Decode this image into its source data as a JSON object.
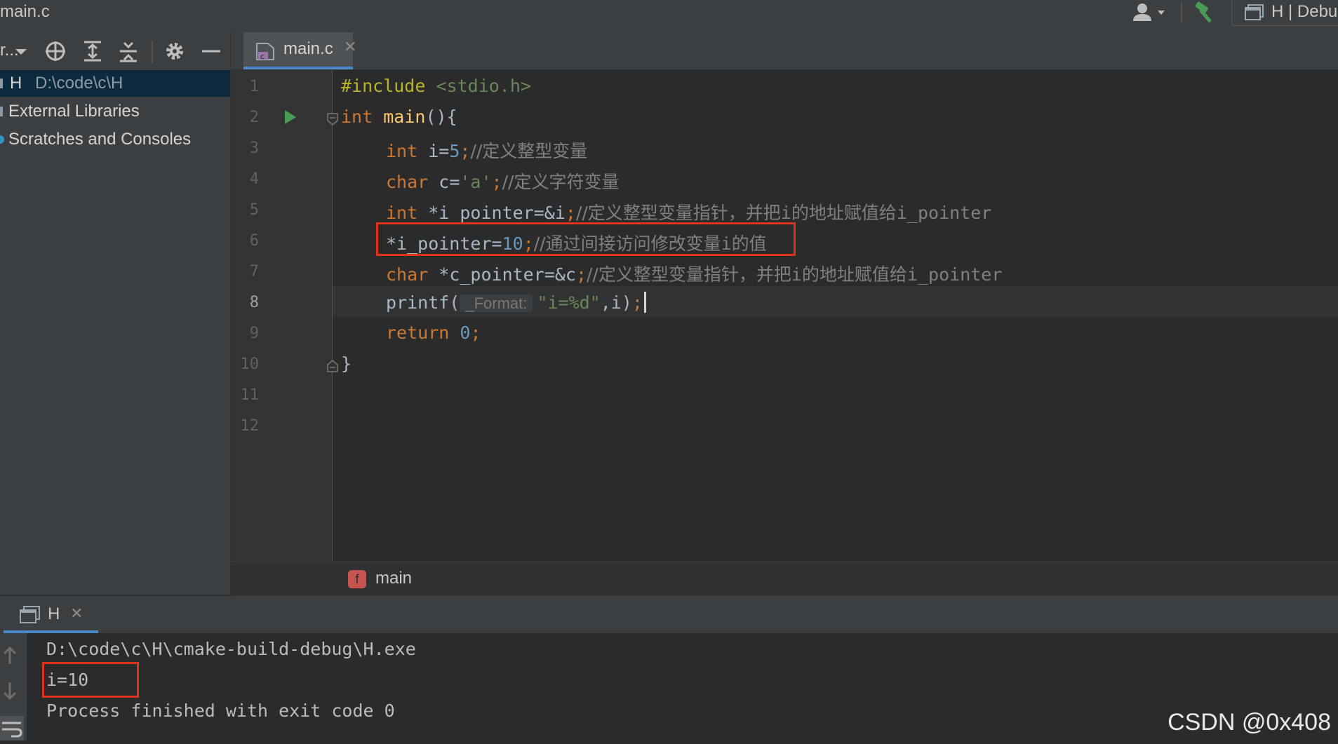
{
  "window": {
    "title_file": "main.c",
    "run_config": "H | Debu"
  },
  "project": {
    "dropdown": "r...",
    "items": [
      {
        "name": "H",
        "path": "D:\\code\\c\\H"
      },
      {
        "name": "External Libraries"
      },
      {
        "name": "Scratches and Consoles"
      }
    ]
  },
  "editor": {
    "tab": {
      "label": "main.c",
      "close": "✕"
    },
    "line_numbers": [
      "1",
      "2",
      "3",
      "4",
      "5",
      "6",
      "7",
      "8",
      "9",
      "10",
      "11",
      "12"
    ],
    "code": {
      "l1_directive": "#include",
      "l1_header": "<stdio.h>",
      "l2_kw": "int",
      "l2_fn": "main",
      "l2_rest": "(){",
      "l3_kw": "int",
      "l3_a": " i=",
      "l3_num": "5",
      "l3_semi": ";",
      "l3_cmt": "//定义整型变量",
      "l4_kw": "char",
      "l4_a": " c=",
      "l4_str": "'a'",
      "l4_semi": ";",
      "l4_cmt": "//定义字符变量",
      "l5_kw": "int",
      "l5_a": " *i_pointer=&i",
      "l5_semi": ";",
      "l5_cmt1": "//定义整型变量指针，并把",
      "l5_cmt2": "i",
      "l5_cmt3": "的地址赋值给",
      "l5_cmt4": "i_pointer",
      "l6_a": "*i_pointer=",
      "l6_num": "10",
      "l6_semi": ";",
      "l6_cmt1": "//通过间接访问修改变量",
      "l6_cmt2": "i",
      "l6_cmt3": "的值",
      "l7_kw": "char",
      "l7_a": " *c_pointer=&c",
      "l7_semi": ";",
      "l7_cmt1": "//定义整型变量指针，并把",
      "l7_cmt2": "i",
      "l7_cmt3": "的地址赋值给",
      "l7_cmt4": "i_pointer",
      "l8_a": "printf(",
      "l8_hint": "_Format:",
      "l8_str": "\"i=%d\"",
      "l8_b": ",i)",
      "l8_semi": ";",
      "l9_kw": "return",
      "l9_num": "0",
      "l9_semi": ";",
      "l10": "}"
    },
    "breadcrumb": {
      "icon_letter": "f",
      "label": "main"
    }
  },
  "run": {
    "tab_label": "H",
    "close": "✕",
    "output": [
      "D:\\code\\c\\H\\cmake-build-debug\\H.exe",
      "i=10",
      "Process finished with exit code 0"
    ]
  },
  "watermark": "CSDN @0x408",
  "colors": {
    "accent": "#4a88c7",
    "highlight_box": "#e0331c",
    "run_green": "#499c54"
  }
}
